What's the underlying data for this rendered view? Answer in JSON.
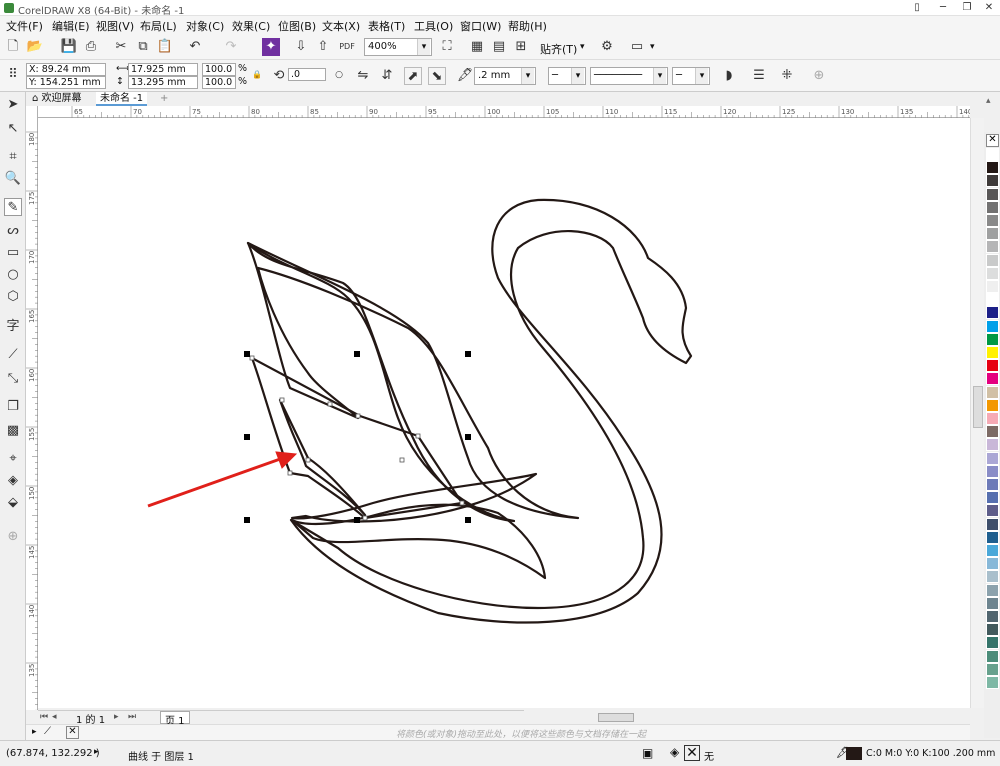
{
  "window": {
    "title": "CorelDRAW X8 (64-Bit) - 未命名 -1",
    "minimize": "─",
    "restore": "❐",
    "close": "✕"
  },
  "menu": [
    "文件(F)",
    "编辑(E)",
    "视图(V)",
    "布局(L)",
    "对象(C)",
    "效果(C)",
    "位图(B)",
    "文本(X)",
    "表格(T)",
    "工具(O)",
    "窗口(W)",
    "帮助(H)"
  ],
  "toolbar": {
    "zoom": "400%",
    "snap": "贴齐(T)",
    "pdf": "PDF"
  },
  "property_bar": {
    "x": "X: 89.24 mm",
    "y": "Y: 154.251 mm",
    "width": "17.925 mm",
    "height": "13.295 mm",
    "scale_w": "100.0",
    "scale_h": "100.0",
    "percent": "%",
    "rotation": ".0",
    "outline_width": ".2 mm"
  },
  "tabs": {
    "welcome": "欢迎屏幕",
    "doc": "未命名 -1",
    "add": "+"
  },
  "ruler_h": [
    "65",
    "70",
    "75",
    "80",
    "85",
    "90",
    "95",
    "100",
    "105",
    "110",
    "115",
    "120",
    "125",
    "130",
    "135",
    "140"
  ],
  "ruler_v": [
    "180",
    "175",
    "170",
    "165",
    "160",
    "155",
    "150",
    "145",
    "140",
    "135"
  ],
  "page_nav": {
    "count": "1 的 1",
    "page": "页 1"
  },
  "doc_palette_hint": "将颜色(或对象)拖动至此处，以便将这些颜色与文档存储在一起",
  "status": {
    "coords": "(67.874, 132.292 )",
    "object": "曲线 于 图层 1",
    "fill": "无",
    "outline": "C:0 M:0 Y:0 K:100  .200 mm"
  },
  "colors": {
    "accent": "#7030a0",
    "arrow": "#e0201a",
    "selection": "#000000"
  },
  "palette_colors": [
    "#ffffff",
    "#231815",
    "#3e3a39",
    "#595757",
    "#727171",
    "#898989",
    "#9fa0a0",
    "#b5b5b6",
    "#c9caca",
    "#dcdddd",
    "#efefef",
    "#ffffff",
    "#1d2088",
    "#00a0e9",
    "#009944",
    "#fff100",
    "#e60012",
    "#e4007f",
    "#d1c0a5",
    "#f39800",
    "#f6aab5",
    "#7d6b65",
    "#c9b7d8",
    "#aba7d5",
    "#8a8dc7",
    "#6d7ab8",
    "#566faf",
    "#5e5d8a",
    "#3e4f6b",
    "#1f5f8f",
    "#4aa8d9",
    "#87b8d8",
    "#a9bfcc",
    "#8ca2ad",
    "#6e8590",
    "#51656f",
    "#425a5d",
    "#35746a",
    "#4c8d7a",
    "#67a18d",
    "#7eb8a5"
  ]
}
